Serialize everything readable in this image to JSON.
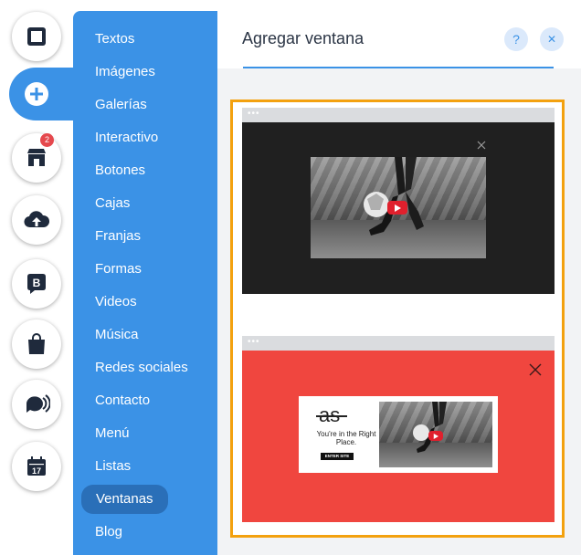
{
  "rail": {
    "items": [
      {
        "name": "pages-icon"
      },
      {
        "name": "add-icon"
      },
      {
        "name": "app-market-icon",
        "badge": "2"
      },
      {
        "name": "upload-icon"
      },
      {
        "name": "blog-b-icon"
      },
      {
        "name": "store-bag-icon"
      },
      {
        "name": "chat-icon"
      },
      {
        "name": "calendar-icon",
        "label": "17"
      }
    ]
  },
  "menu": {
    "items": [
      "Textos",
      "Imágenes",
      "Galerías",
      "Interactivo",
      "Botones",
      "Cajas",
      "Franjas",
      "Formas",
      "Videos",
      "Música",
      "Redes sociales",
      "Contacto",
      "Menú",
      "Listas",
      "Ventanas",
      "Blog"
    ],
    "selected": "Ventanas"
  },
  "panel": {
    "title": "Agregar ventana",
    "help_label": "?",
    "close_label": "✕"
  },
  "cards": {
    "browser_dots": "•••",
    "promo_logo": "as",
    "promo_text": "You're in the Right Place.",
    "promo_button": "ENTER SITE"
  },
  "colors": {
    "accent": "#3b92e6",
    "selected_item": "#2a6fb8",
    "selection_border": "#f3a10f",
    "dark_window": "#202020",
    "red_window": "#f0463f",
    "play": "#e0202d"
  }
}
